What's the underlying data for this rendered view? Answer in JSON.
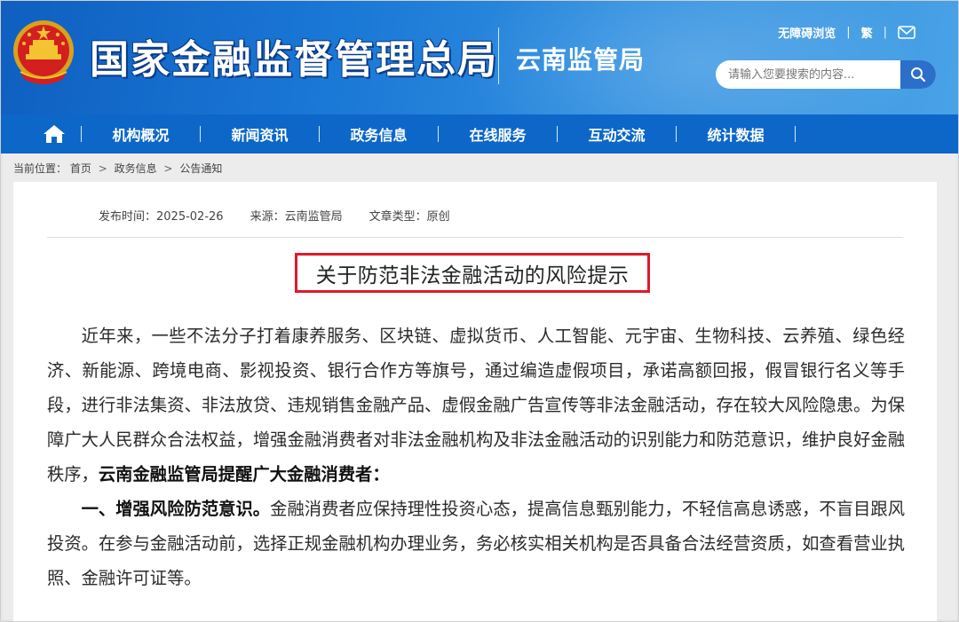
{
  "header": {
    "site_title": "国家金融监督管理总局",
    "sub_title": "云南监管局",
    "accessibility_link": "无障碍浏览",
    "traditional_link": "繁",
    "search_placeholder": "请输入您要搜索的内容...",
    "colors": {
      "header_start": "#0f5fc0",
      "header_end": "#4aa2e6",
      "nav": "#0c67c8",
      "highlight": "#e0192a"
    }
  },
  "nav": {
    "home_icon": "home-icon",
    "items": [
      "机构概况",
      "新闻资讯",
      "政务信息",
      "在线服务",
      "互动交流",
      "统计数据"
    ]
  },
  "breadcrumb": {
    "prefix": "当前位置：",
    "items": [
      "首页",
      "政务信息",
      "公告通知"
    ],
    "separator": ">"
  },
  "article": {
    "publish_label": "发布时间：",
    "publish_date": "2025-02-26",
    "source_label": "来源：",
    "source": "云南监管局",
    "type_label": "文章类型：",
    "type": "原创",
    "title": "关于防范非法金融活动的风险提示",
    "p1": "近年来，一些不法分子打着康养服务、区块链、虚拟货币、人工智能、元宇宙、生物科技、云养殖、绿色经济、新能源、跨境电商、影视投资、银行合作方等旗号，通过编造虚假项目，承诺高额回报，假冒银行名义等手段，进行非法集资、非法放贷、违规销售金融产品、虚假金融广告宣传等非法金融活动，存在较大风险隐患。为保障广大人民群众合法权益，增强金融消费者对非法金融机构及非法金融活动的识别能力和防范意识，维护良好金融秩序，",
    "p1_bold": "云南金融监管局提醒广大金融消费者：",
    "p2_bold": "一、增强风险防范意识。",
    "p2": "金融消费者应保持理性投资心态，提高信息甄别能力，不轻信高息诱惑，不盲目跟风投资。在参与金融活动前，选择正规金融机构办理业务，务必核实相关机构是否具备合法经营资质，如查看营业执照、金融许可证等。"
  }
}
